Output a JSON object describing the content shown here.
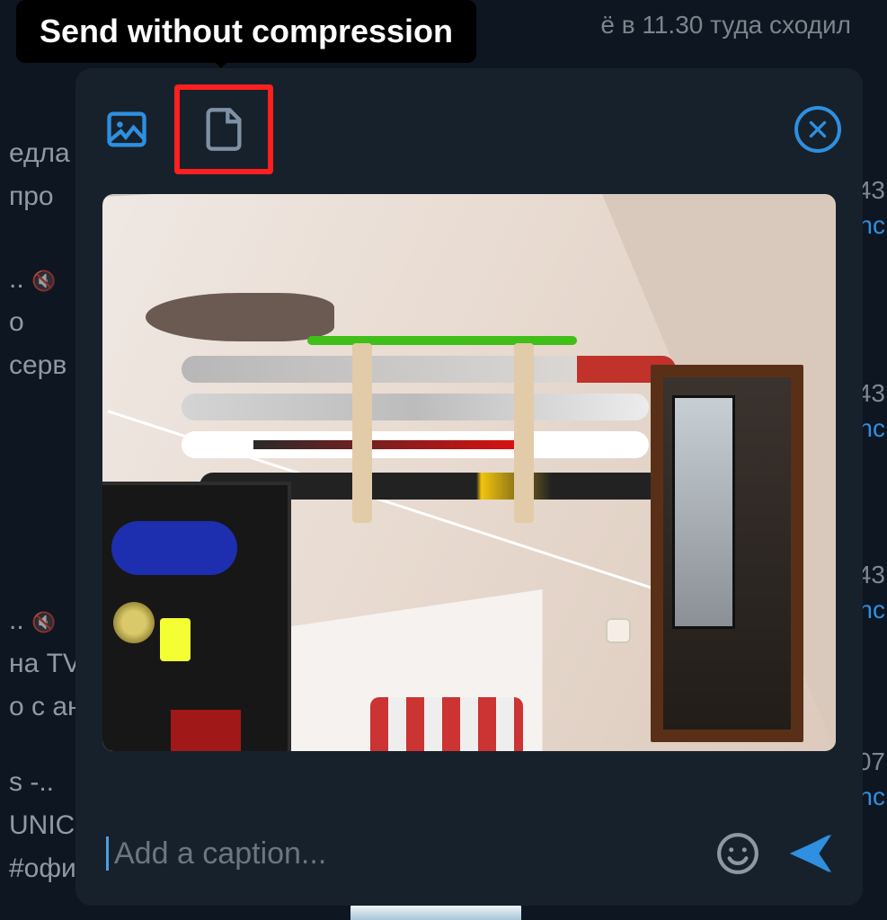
{
  "tooltip": {
    "text": "Send without compression"
  },
  "background": {
    "top_text": "ё в 11.30 туда сходил",
    "left": {
      "r1": "едла",
      "r2": "про",
      "r3": "..",
      "r4": "о",
      "r5": "серв",
      "r6": "..",
      "r7": "на TV",
      "r8": "о с ан",
      "r9": "s -..",
      "r10": "UNIC",
      "r11": "#офи"
    },
    "right": {
      "t1": "43",
      "l1": "inc",
      "t2": "43",
      "l2": "inc",
      "t3": "43",
      "l3": "inc",
      "t4": "07",
      "l4": "inc"
    }
  },
  "modal": {
    "icons": {
      "media": "image-icon",
      "file": "file-icon",
      "close": "close-icon",
      "emoji": "emoji-icon",
      "send": "send-icon"
    },
    "caption_placeholder": "Add a caption...",
    "caption_value": ""
  },
  "colors": {
    "accent": "#2f8fe0",
    "highlight": "#ff1f1f",
    "panel": "#17212b"
  }
}
